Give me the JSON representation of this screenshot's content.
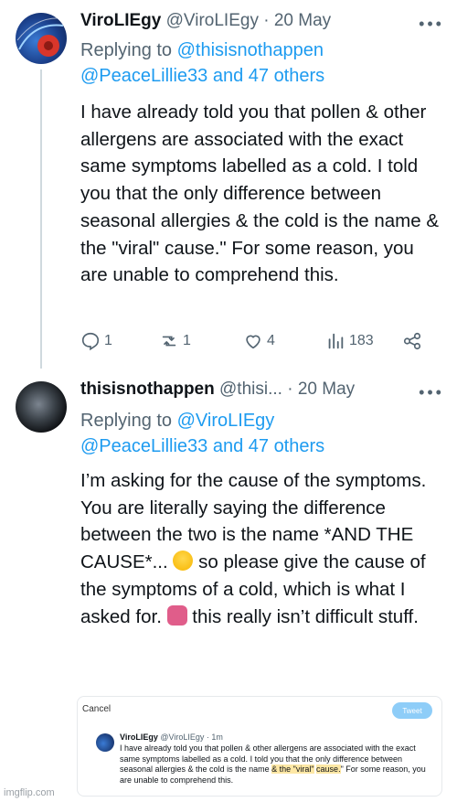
{
  "tweets": [
    {
      "name": "ViroLIEgy",
      "handle": "@ViroLIEgy",
      "dot": "·",
      "date": "20 May",
      "replying_prefix": "Replying to",
      "replying_mention1": "@thisisnothappen",
      "replying_mention2": "@PeaceLillie33 and 47 others",
      "body": "I have already told you that pollen & other allergens are associated with the exact same symptoms labelled as a cold. I told you that the only difference between seasonal allergies & the cold is the name & the \"viral\" cause.\" For some reason, you are unable to comprehend this.",
      "replies": "1",
      "retweets": "1",
      "likes": "4",
      "views": "183",
      "icons": [
        "reply-icon",
        "retweet-icon",
        "like-icon",
        "views-icon",
        "share-icon"
      ]
    },
    {
      "name": "thisisnothappen",
      "handle": "@thisi...",
      "dot": "·",
      "date": "20 May",
      "replying_prefix": "Replying to",
      "replying_mention1": "@ViroLIEgy",
      "replying_mention2": "@PeaceLillie33 and 47 others",
      "body_part1": "I’m asking for the cause of the symptoms. You are literally saying the difference between the two is the name *AND THE CAUSE*...",
      "body_part2": "so please give the cause of the symptoms of a cold, which is what I asked for.",
      "body_part3": "this really isn’t difficult stuff."
    }
  ],
  "quote_screenshot": {
    "cancel": "Cancel",
    "tweet_button": "Tweet",
    "name": "ViroLIEgy",
    "handle_time": "@ViroLIEgy · 1m",
    "body_a": "I have already told you that pollen & other allergens are associated with the exact same symptoms labelled as a cold. I told you that the only difference between seasonal allergies & the cold is the name",
    "body_highlight1": "& the \"viral\"",
    "body_highlight2": "cause.",
    "body_b": "\" For some reason, you are unable to comprehend this."
  },
  "watermark": "imgflip.com",
  "colors": {
    "accent": "#1d9bf0",
    "muted": "#536471",
    "divider": "#cfd9de"
  }
}
